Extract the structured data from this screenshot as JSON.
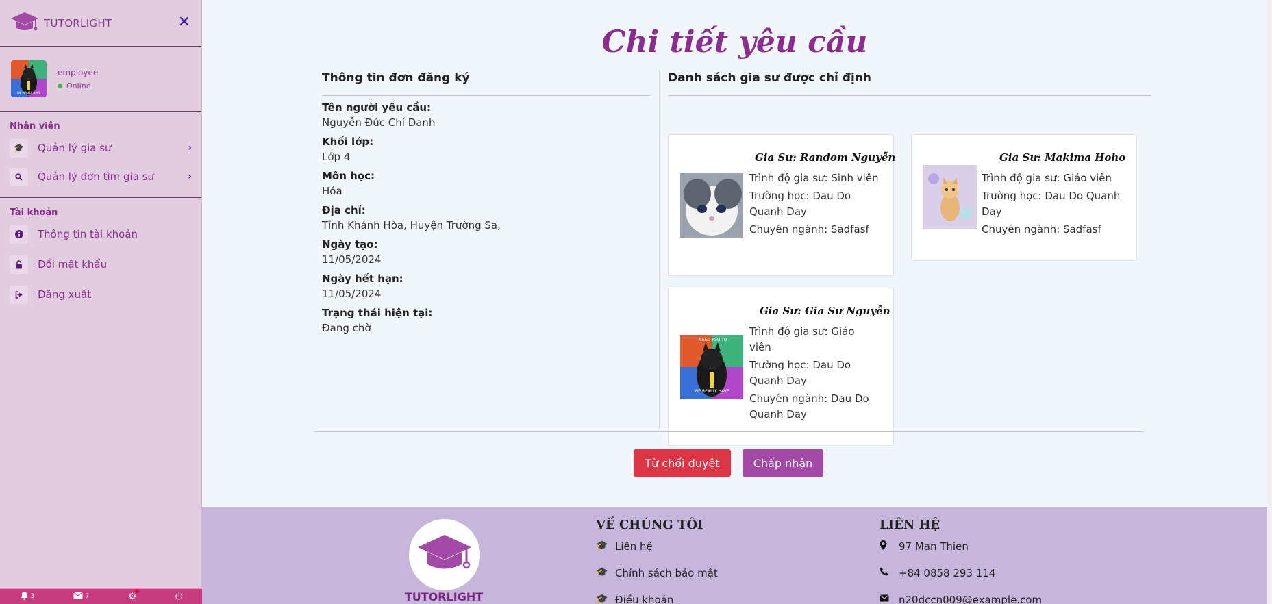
{
  "sidebar": {
    "brand": "TUTORLIGHT",
    "user": {
      "name": "employee",
      "status": "Online"
    },
    "section_staff": "Nhân viên",
    "staff_items": [
      {
        "label": "Quản lý gia sư",
        "icon": "graduation-cap-icon"
      },
      {
        "label": "Quản lý đơn tìm gia sư",
        "icon": "search-icon"
      }
    ],
    "section_account": "Tài khoản",
    "account_items": [
      {
        "label": "Thông tin tài khoản",
        "icon": "info-icon"
      },
      {
        "label": "Đổi mật khẩu",
        "icon": "lock-icon"
      },
      {
        "label": "Đăng xuất",
        "icon": "sign-out-icon"
      }
    ],
    "bottom": {
      "notifications": "3",
      "messages": "7"
    }
  },
  "page": {
    "title": "Chi tiết yêu cầu",
    "left_heading": "Thông tin đơn đăng ký",
    "right_heading": "Danh sách gia sư được chỉ định",
    "fields": [
      {
        "label": "Tên người yêu cầu:",
        "value": "Nguyễn Đức Chí Danh"
      },
      {
        "label": "Khối lớp:",
        "value": "Lớp 4"
      },
      {
        "label": "Môn học:",
        "value": "Hóa"
      },
      {
        "label": "Địa chỉ:",
        "value": "Tỉnh Khánh Hòa, Huyện Trường Sa,"
      },
      {
        "label": "Ngày tạo:",
        "value": "11/05/2024"
      },
      {
        "label": "Ngày hết hạn:",
        "value": "11/05/2024"
      },
      {
        "label": "Trạng thái hiện tại:",
        "value": "Đang chờ"
      }
    ],
    "tutors": [
      {
        "name": "Gia Sư: Random Nguyễn",
        "level": "Trình độ gia sư: Sinh viên",
        "school": "Trường học: Dau Do Quanh Day",
        "major": "Chuyên ngành: Sadfasf"
      },
      {
        "name": "Gia Sư: Makima Hoho",
        "level": "Trình độ gia sư: Giáo viên",
        "school": "Trường học: Dau Do Quanh Day",
        "major": "Chuyên ngành: Sadfasf"
      },
      {
        "name": "Gia Sư: Gia Sư Nguyễn",
        "level": "Trình độ gia sư: Giáo viên",
        "school": "Trường học: Dau Do Quanh Day",
        "major": "Chuyên ngành: Dau Do Quanh Day"
      }
    ],
    "reject_label": "Từ chối duyệt",
    "accept_label": "Chấp nhận"
  },
  "footer": {
    "brand": "TUTORLIGHT",
    "about_title": "VỀ CHÚNG TÔI",
    "about_items": [
      "Liên hệ",
      "Chính sách bảo mật",
      "Điều khoản"
    ],
    "contact_title": "LIÊN HỆ",
    "contact_items": [
      "97 Man Thien",
      "+84 0858 293 114",
      "n20dccn009@example.com"
    ]
  },
  "colors": {
    "accent": "#8a2d8e",
    "reject": "#dc3545",
    "accept": "#a24aa6",
    "footer_bg": "#c7b6dc",
    "sidebar_bg": "#e1cce0"
  }
}
